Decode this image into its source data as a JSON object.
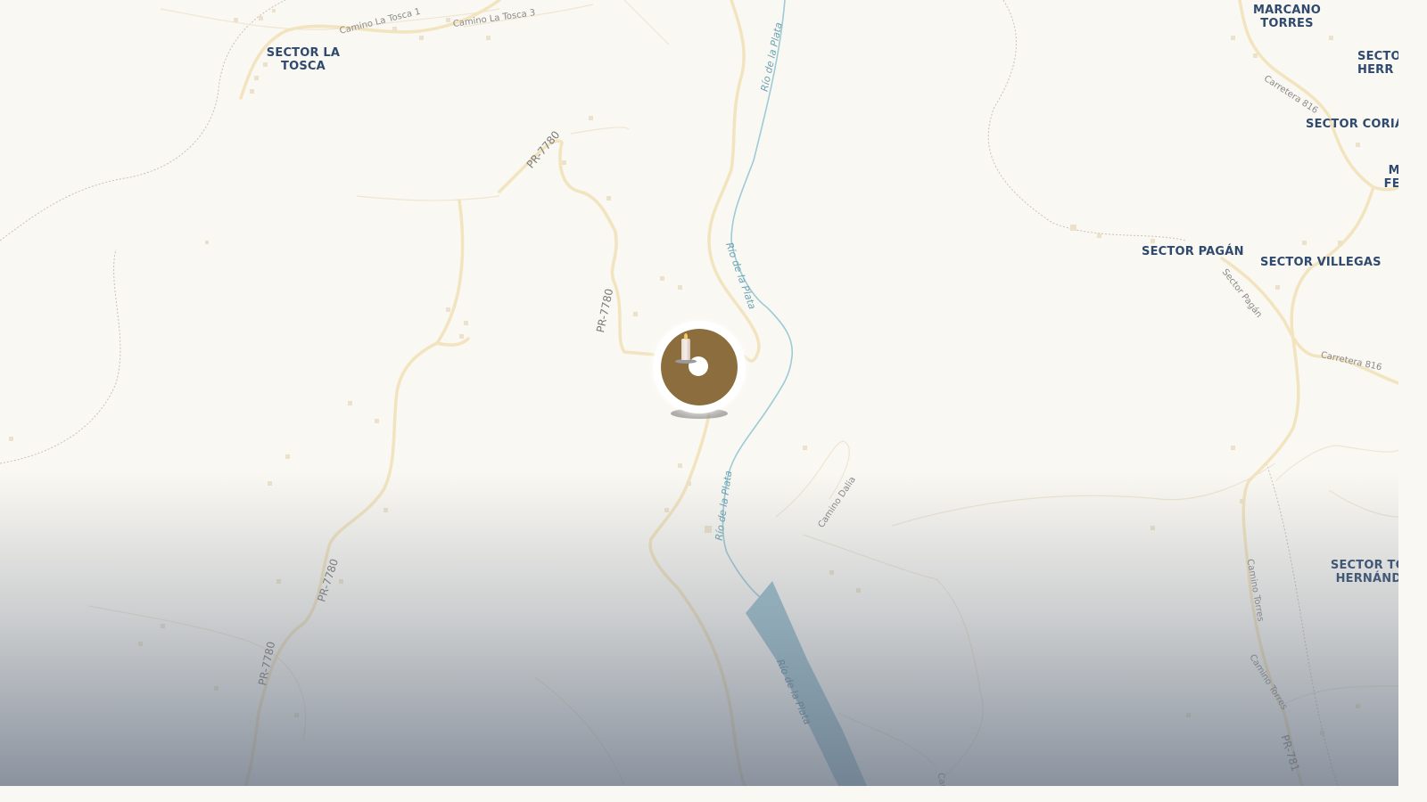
{
  "map": {
    "colors": {
      "land": "#faf8f2",
      "road": "#f3e4c0",
      "river": "#9dcbd6",
      "label": "#2f4a6e"
    },
    "places": [
      {
        "id": "sector-la-tosca",
        "text": "SECTOR LA\nTOSCA"
      },
      {
        "id": "marcano-torres",
        "text": "MARCANO\nTORRES"
      },
      {
        "id": "sector-herr",
        "text": "SECTO\nHERR"
      },
      {
        "id": "sector-corian",
        "text": "SECTOR CORIAN"
      },
      {
        "id": "sector-ma-fer",
        "text": "S\nMA\nFER"
      },
      {
        "id": "sector-pagan",
        "text": "SECTOR PAGÁN"
      },
      {
        "id": "sector-villegas",
        "text": "SECTOR VILLEGAS"
      },
      {
        "id": "sector-tor-hernandez",
        "text": "SECTOR TOR\nHERNÁNDE"
      }
    ],
    "roads": {
      "camino_la_tosca_1": "Camino La Tosca 1",
      "camino_la_tosca_3": "Camino La Tosca 3",
      "pr7780_a": "PR-7780",
      "pr7780_b": "PR-7780",
      "pr7780_c": "PR-7780",
      "pr7780_d": "PR-7780",
      "carretera_816_a": "Carretera 816",
      "carretera_816_b": "Carretera 816",
      "sector_pagan": "Sector Pagán",
      "camino_dalia": "Camino Dalia",
      "camino_torres_a": "Camino Torres",
      "camino_torres_b": "Camino Torres",
      "pr781": "PR-781",
      "cam_partial": "Cam"
    },
    "river": {
      "a": "Río de la Plata",
      "b": "Río de la Plata",
      "c": "Río de la Plata",
      "d": "Río de la Plata"
    },
    "marker": {
      "icon": "candle-icon"
    }
  }
}
